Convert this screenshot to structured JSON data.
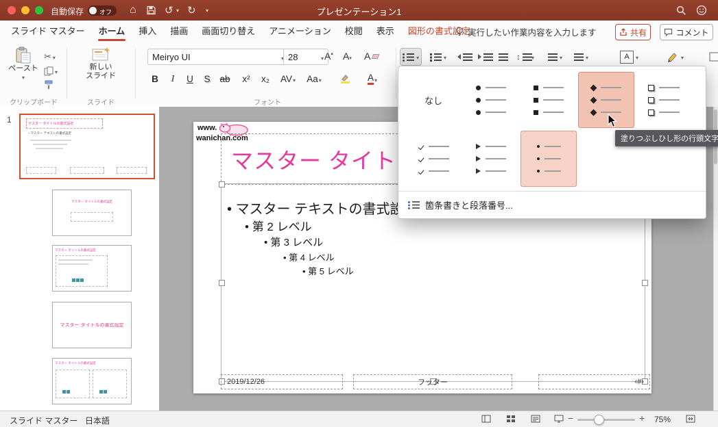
{
  "colors": {
    "titlebar": "#8E3A2A",
    "accent_red": "#C2472E",
    "title_magenta": "#E6399B",
    "menu_highlight_fill": "#F2C2B3",
    "menu_highlight_border": "#DE8F77",
    "selected_thumb_border": "#CF5230"
  },
  "titlebar": {
    "autosave_label": "自動保存",
    "autosave_state": "オフ",
    "title": "プレゼンテーション1"
  },
  "tabbar": {
    "tabs": [
      {
        "label": "スライド マスター"
      },
      {
        "label": "ホーム"
      },
      {
        "label": "挿入"
      },
      {
        "label": "描画"
      },
      {
        "label": "画面切り替え"
      },
      {
        "label": "アニメーション"
      },
      {
        "label": "校閲"
      },
      {
        "label": "表示"
      },
      {
        "label": "図形の書式設定"
      }
    ],
    "active_tab": "ホーム",
    "tell_me": "実行したい作業内容を入力します",
    "share": "共有",
    "comments": "コメント"
  },
  "ribbon": {
    "paste": "ペースト",
    "new_slide_line1": "新しい",
    "new_slide_line2": "スライド",
    "font_name": "Meiryo UI",
    "font_size": "28",
    "buttons": {
      "bold": "B",
      "italic": "I",
      "underline": "U",
      "shadow": "S",
      "strike": "ab",
      "superscript": "x²",
      "subscript": "x₂",
      "char_spacing": "AV",
      "change_case": "Aa",
      "font_color": "A",
      "grow_font": "A",
      "shrink_font": "A",
      "clear_format": "A",
      "text_icon": "A"
    },
    "groups": {
      "clipboard": "クリップボード",
      "slide": "スライド",
      "font": "フォント"
    }
  },
  "bullet_menu": {
    "none": "なし",
    "tooltip": "塗りつぶしひし形の行頭文字",
    "footer": "箇条書きと段落番号...",
    "options": [
      {
        "name": "filled-round",
        "glyph": "●"
      },
      {
        "name": "filled-square",
        "glyph": "■"
      },
      {
        "name": "filled-diamond",
        "glyph": "◆",
        "state": "hover"
      },
      {
        "name": "hollow-square",
        "glyph": "❑"
      },
      {
        "name": "checkmark",
        "glyph": "✓"
      },
      {
        "name": "arrow",
        "glyph": "➢"
      },
      {
        "name": "small-dot",
        "glyph": "•",
        "state": "selected"
      }
    ]
  },
  "sidebar": {
    "slide_number": "1",
    "thumbnails": [
      {
        "title": "マスター タイトルの書式設定",
        "body": "・マスター テキストの書式設定"
      },
      {
        "title": "マスター タイトルの書式設定"
      },
      {
        "title": "マスター タイトルの書式設定"
      },
      {
        "title": "マスター タイトルの書式設定"
      },
      {
        "title": "マスター タイトルの書式設定"
      }
    ]
  },
  "slide": {
    "logo_line1": "www.",
    "logo_line2": "wanichan.com",
    "title": "マスター タイトルの書式設定",
    "bullets": [
      "マスター テキストの書式設定",
      "第 2 レベル",
      "第 3 レベル",
      "第 4 レベル",
      "第 5 レベル"
    ],
    "footer_date": "2019/12/26",
    "footer_text": "フッター",
    "footer_page": "‹#›"
  },
  "statusbar": {
    "view_label": "スライド マスター",
    "language": "日本語",
    "zoom": "75%"
  }
}
